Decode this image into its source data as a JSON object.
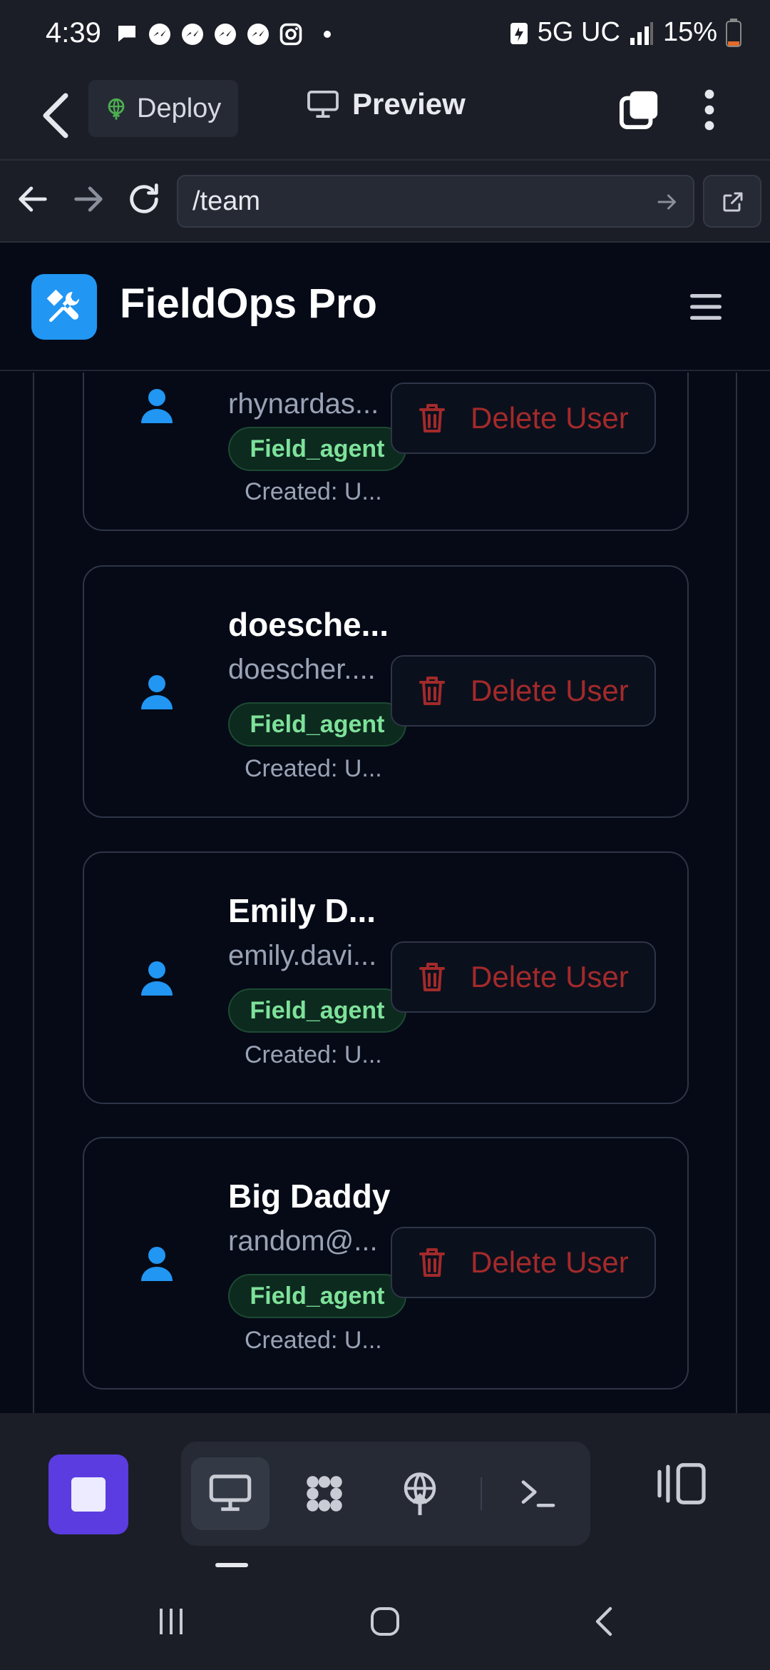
{
  "status_bar": {
    "time": "4:39",
    "network": "5G UC",
    "battery": "15%"
  },
  "header": {
    "deploy_label": "Deploy",
    "preview_label": "Preview"
  },
  "url_bar": {
    "url": "/team"
  },
  "app": {
    "title": "FieldOps Pro",
    "brand_color": "#2196f3"
  },
  "users": [
    {
      "name": "",
      "email": "rhynardas...",
      "role": "Field_agent",
      "created": "Created: U...",
      "delete_label": "Delete User"
    },
    {
      "name": "doesche...",
      "email": "doescher....",
      "role": "Field_agent",
      "created": "Created: U...",
      "delete_label": "Delete User"
    },
    {
      "name": "Emily D...",
      "email": "emily.davi...",
      "role": "Field_agent",
      "created": "Created: U...",
      "delete_label": "Delete User"
    },
    {
      "name": "Big Daddy",
      "email": "random@...",
      "role": "Field_agent",
      "created": "Created: U...",
      "delete_label": "Delete User"
    }
  ],
  "colors": {
    "danger": "#a32a2a",
    "role_badge_text": "#7ee29a",
    "accent_purple": "#5b3ce0"
  }
}
